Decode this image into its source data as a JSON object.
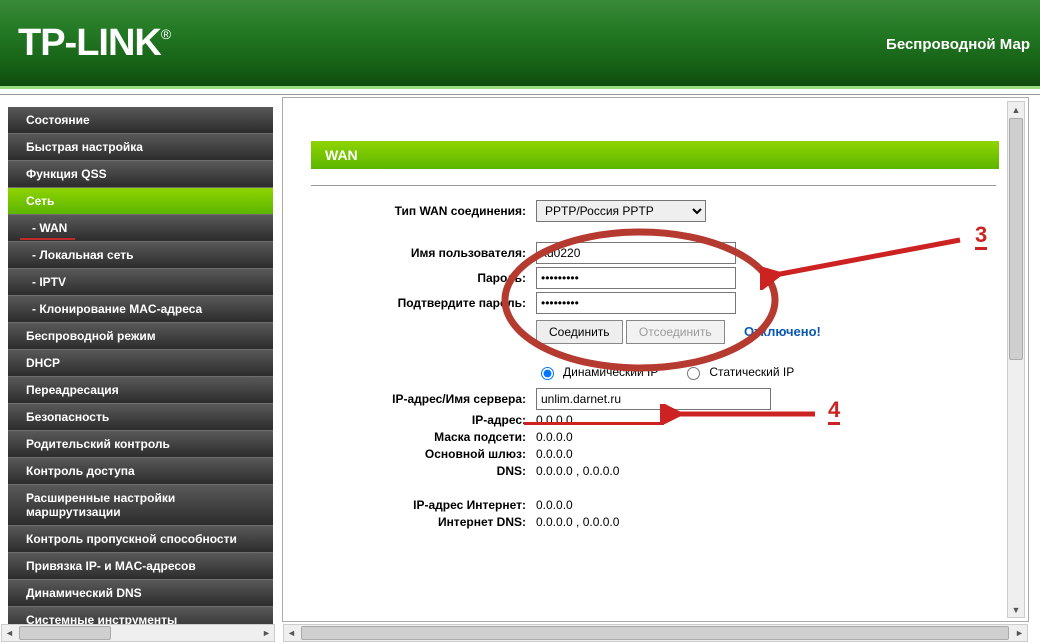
{
  "header": {
    "logo": "TP-LINK",
    "model": "Беспроводной Мар"
  },
  "nav": {
    "status": "Состояние",
    "quick": "Быстрая настройка",
    "qss": "Функция QSS",
    "net": "Сеть",
    "wan": "- WAN",
    "lan": "- Локальная сеть",
    "iptv": "- IPTV",
    "macclone": "- Клонирование MAC-адреса",
    "wireless": "Беспроводной режим",
    "dhcp": "DHCP",
    "forward": "Переадресация",
    "security": "Безопасность",
    "parental": "Родительский контроль",
    "access": "Контроль доступа",
    "advrouting": "Расширенные настройки маршрутизации",
    "bandwidth": "Контроль пропускной способности",
    "ipmac": "Привязка IP- и MAC-адресов",
    "ddns": "Динамический DNS",
    "tools": "Системные инструменты"
  },
  "page": {
    "title": "WAN",
    "labels": {
      "conn_type": "Тип WAN соединения:",
      "username": "Имя пользователя:",
      "password": "Пароль:",
      "confirm": "Подтвердите пароль:",
      "dynip": "Динамический IP",
      "statip": "Статический IP",
      "server": "IP-адрес/Имя сервера:",
      "ip": "IP-адрес:",
      "mask": "Маска подсети:",
      "gw": "Основной шлюз:",
      "dns": "DNS:",
      "inet_ip": "IP-адрес Интернет:",
      "inet_dns": "Интернет DNS:"
    },
    "values": {
      "conn_type": "PPTP/Россия PPTP",
      "username": "xd0220",
      "password": "•••••••••",
      "confirm": "•••••••••",
      "server": "unlim.darnet.ru",
      "ip": "0.0.0.0",
      "mask": "0.0.0.0",
      "gw": "0.0.0.0",
      "dns": "0.0.0.0 , 0.0.0.0",
      "inet_ip": "0.0.0.0",
      "inet_dns": "0.0.0.0 , 0.0.0.0"
    },
    "buttons": {
      "connect": "Соединить",
      "disconnect": "Отсоединить"
    },
    "status": "Отключено!"
  },
  "annotations": {
    "n3": "3",
    "n4": "4"
  }
}
